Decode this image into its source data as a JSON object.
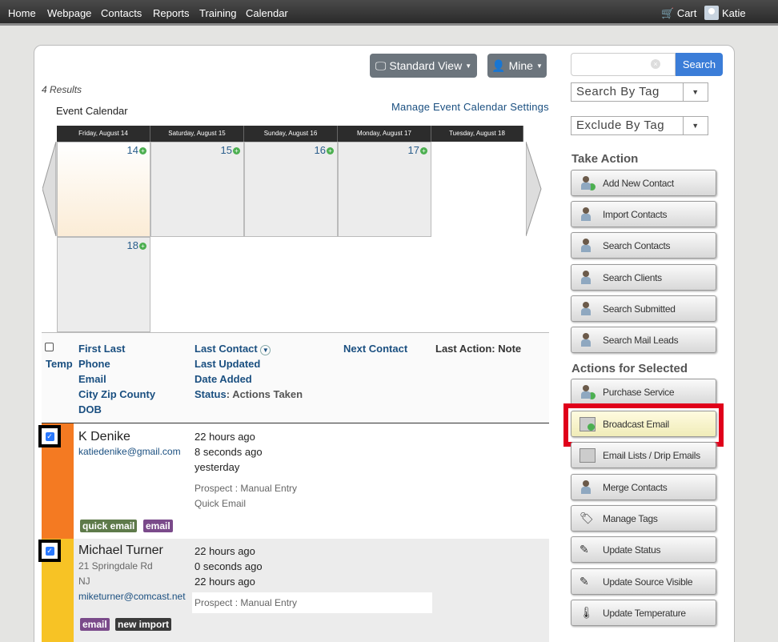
{
  "nav": {
    "items": [
      "Home",
      "Webpage",
      "Contacts",
      "Reports",
      "Training",
      "Calendar"
    ],
    "cart": "Cart",
    "user": "Katie"
  },
  "toolbar": {
    "view": "Standard View",
    "owner": "Mine"
  },
  "results": "4 Results",
  "calendar": {
    "title": "Event Calendar",
    "manage": "Manage Event Calendar Settings",
    "days": [
      "Friday, August 14",
      "Saturday, August 15",
      "Sunday, August 16",
      "Monday, August 17",
      "Tuesday, August 18"
    ],
    "nums": [
      "14",
      "15",
      "16",
      "17",
      "18"
    ]
  },
  "headers": {
    "temp": "Temp",
    "first_last": "First Last",
    "phone": "Phone",
    "email": "Email",
    "city": "City Zip County",
    "dob": "DOB",
    "last_contact": "Last Contact",
    "last_updated": "Last Updated",
    "date_added": "Date Added",
    "status": "Status",
    "actions_taken": ": Actions Taken",
    "next_contact": "Next Contact",
    "last_action": "Last Action: Note"
  },
  "rows": [
    {
      "name": "K Denike",
      "email": "katiedenike@gmail.com",
      "last_contact": "22 hours ago",
      "last_updated": "8 seconds ago",
      "date_added": "yesterday",
      "status": "Prospect : Manual Entry",
      "action": "Quick Email",
      "tags": [
        "quick email",
        "email"
      ]
    },
    {
      "name": "Michael Turner",
      "address": "21 Springdale Rd",
      "state": "NJ",
      "email": "miketurner@comcast.net",
      "last_contact": "22 hours ago",
      "last_updated": "0 seconds ago",
      "date_added": "22 hours ago",
      "status": "Prospect : Manual Entry",
      "tags": [
        "email",
        "new import"
      ]
    }
  ],
  "sidebar": {
    "search_button": "Search",
    "search_by_tag": "Search By Tag",
    "exclude_by_tag": "Exclude By Tag",
    "take_action": "Take Action",
    "take_action_items": [
      "Add New Contact",
      "Import Contacts",
      "Search Contacts",
      "Search Clients",
      "Search Submitted",
      "Search Mail Leads"
    ],
    "actions_selected": "Actions for Selected",
    "selected_items": [
      "Purchase Service",
      "Broadcast Email",
      "Email Lists / Drip Emails",
      "Merge Contacts",
      "Manage Tags",
      "Update Status",
      "Update Source Visible",
      "Update Temperature"
    ]
  },
  "colors": {
    "highlight": "#e0001a",
    "row1_bar": "#f47a22",
    "row2_bar": "#f7c325",
    "tag_green": "#5e7a4a",
    "tag_purple": "#7a4a8a",
    "link": "#1a4f80"
  }
}
